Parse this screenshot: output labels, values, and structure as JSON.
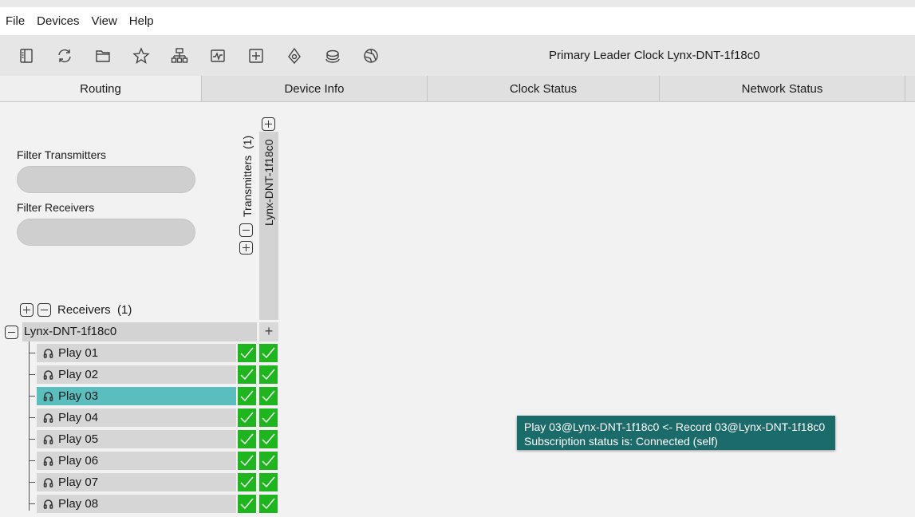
{
  "menu": [
    "File",
    "Devices",
    "View",
    "Help"
  ],
  "toolbar": {
    "icons": [
      "sidebar-icon",
      "refresh-icon",
      "folder-icon",
      "star-icon",
      "network-icon",
      "activity-icon",
      "add-icon",
      "location-icon",
      "storage-icon",
      "globe-icon"
    ],
    "leader_clock": "Primary Leader Clock Lynx-DNT-1f18c0"
  },
  "tabs": [
    {
      "label": "Routing",
      "active": true
    },
    {
      "label": "Device Info",
      "active": false
    },
    {
      "label": "Clock Status",
      "active": false
    },
    {
      "label": "Network Status",
      "active": false
    }
  ],
  "filters": {
    "transmitters_label": "Filter Transmitters",
    "receivers_label": "Filter Receivers"
  },
  "transmitters": {
    "header": "Transmitters",
    "count": "(1)",
    "device": "Lynx-DNT-1f18c0"
  },
  "receivers": {
    "header": "Receivers",
    "count": "(1)",
    "device": "Lynx-DNT-1f18c0",
    "add_symbol": "+",
    "channels": [
      "Play 01",
      "Play 02",
      "Play 03",
      "Play 04",
      "Play 05",
      "Play 06",
      "Play 07",
      "Play 08"
    ],
    "selected": "Play 03"
  },
  "colors": {
    "connected": "#1fb51f",
    "selected_row": "#5bbebe",
    "tooltip_bg": "#1b6b6b"
  },
  "tooltip": {
    "line1": "Play 03@Lynx-DNT-1f18c0 <- Record 03@Lynx-DNT-1f18c0",
    "line2": "Subscription status is: Connected (self)"
  }
}
